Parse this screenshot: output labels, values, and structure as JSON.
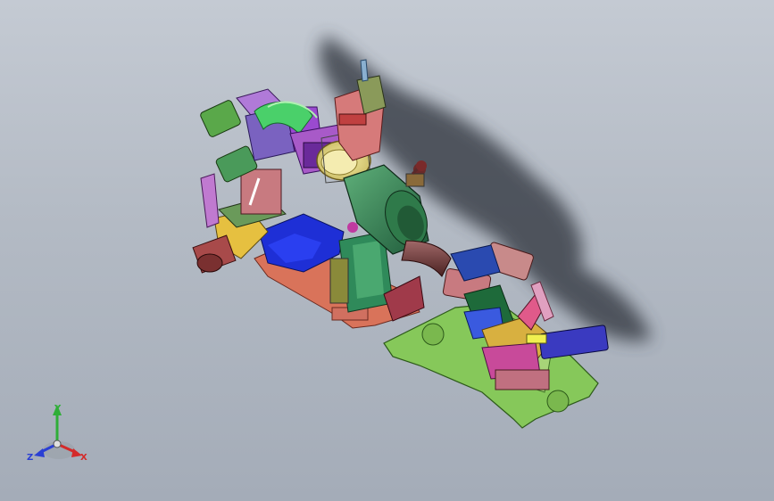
{
  "viewport": {
    "background_top": "#c4cad3",
    "background_bottom": "#a4acb8"
  },
  "triad": {
    "x_label": "X",
    "y_label": "Y",
    "z_label": "Z",
    "x_color": "#d42a2a",
    "y_color": "#2fae38",
    "z_color": "#2a3fd4"
  },
  "model": {
    "icon": "cad-assembly-fixture-icon",
    "colors": {
      "green_plate": "#7fc45a",
      "salmon_plate": "#d9735a",
      "blue_base": "#1e2fd6",
      "teal_block": "#2f8a5a",
      "purple": "#9a5ab8",
      "yellow": "#e6d84a",
      "brown_tube": "#6e3a3a",
      "shadow": "#4a4f58"
    }
  }
}
